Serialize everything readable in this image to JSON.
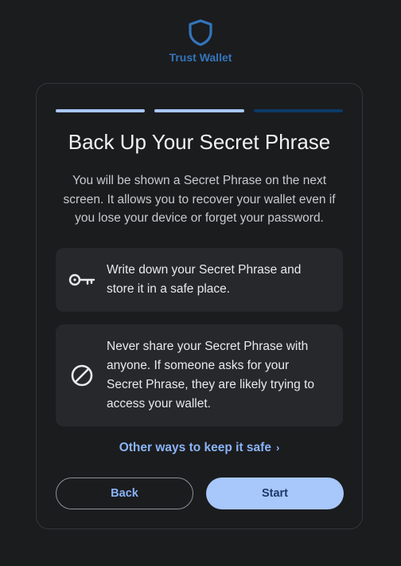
{
  "brand": {
    "name": "Trust Wallet",
    "logo_icon": "shield-icon",
    "color": "#3375bb"
  },
  "progress": {
    "steps": 3,
    "current": 2,
    "colors": {
      "complete": "#a8c7fa",
      "pending": "#0b3a66"
    }
  },
  "card": {
    "title": "Back Up Your Secret Phrase",
    "description": "You will be shown a Secret Phrase on the next screen. It allows you to recover your wallet even if you lose your device or forget your password.",
    "tips": [
      {
        "icon": "key-icon",
        "text": "Write down your Secret Phrase and store it in a safe place."
      },
      {
        "icon": "block-icon",
        "text": "Never share your Secret Phrase with anyone. If someone asks for your Secret Phrase, they are likely trying to access your wallet."
      }
    ],
    "more_link": "Other ways to keep it safe",
    "more_link_chevron": "›"
  },
  "actions": {
    "back_label": "Back",
    "start_label": "Start"
  }
}
